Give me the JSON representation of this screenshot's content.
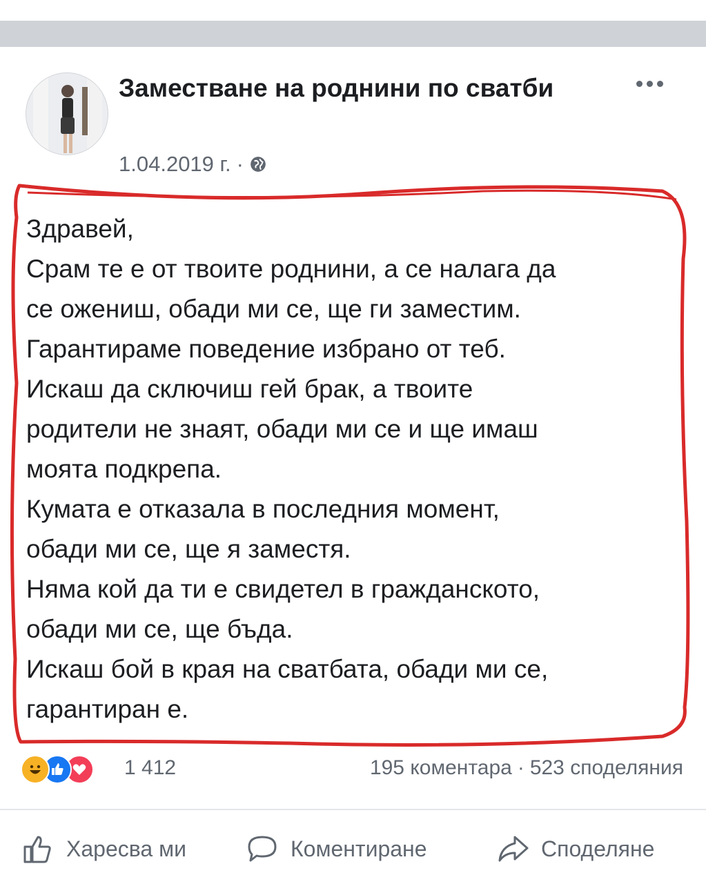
{
  "post": {
    "page_name": "Заместване на роднини по сватби",
    "date": "1.04.2019 г.",
    "separator": "·",
    "body_lines": [
      "Здравей,",
      "Срам те е от твоите роднини, а се налага да",
      "се ожениш, обади ми се, ще ги заместим.",
      "Гарантираме поведение избрано от теб.",
      "Искаш да сключиш гей брак, а твоите",
      "родители не знаят, обади ми се и ще имаш",
      "моята подкрепа.",
      "Кумата е отказала в последния момент,",
      "обади ми се, ще я заместя.",
      "Няма кой да ти е свидетел в гражданското,",
      "обади ми се, ще бъда.",
      "Искаш бой в края на сватбата, обади ми се,",
      "гарантиран е."
    ],
    "annotation_color": "#d92a2a"
  },
  "reactions": {
    "icons": [
      "haha-icon",
      "like-icon",
      "love-icon"
    ],
    "count": "1 412",
    "comments": "195 коментара",
    "dot": "·",
    "shares": "523 споделяния"
  },
  "actions": {
    "like_label": "Харесва ми",
    "comment_label": "Коментиране",
    "share_label": "Споделяне"
  },
  "colors": {
    "text": "#1c1e21",
    "secondary": "#606770",
    "like_blue": "#1877f2",
    "love_red": "#f33e58",
    "haha_yellow": "#f7b125"
  }
}
